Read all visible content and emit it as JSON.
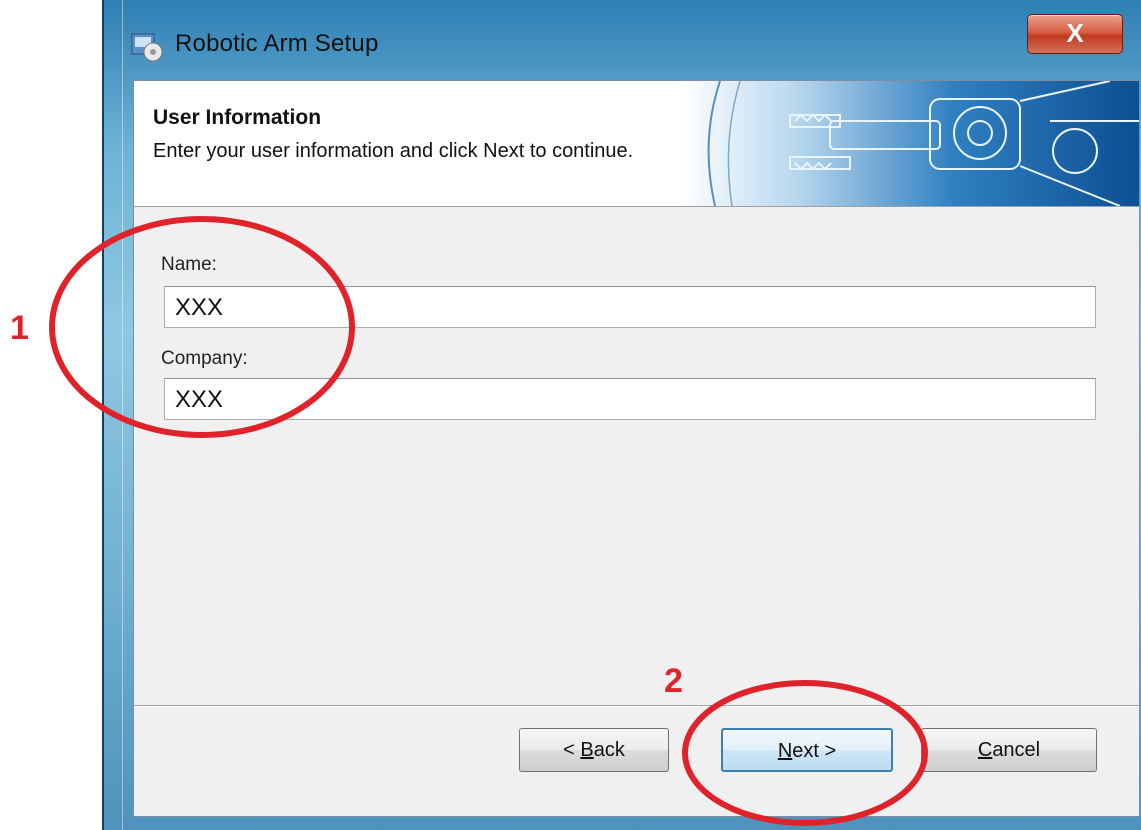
{
  "window": {
    "title": "Robotic Arm Setup",
    "close_label": "X",
    "icon": "setup-installer-icon"
  },
  "header": {
    "title": "User Information",
    "subtitle": "Enter your user information and click Next to continue.",
    "banner_image": "robotic-arm-banner"
  },
  "form": {
    "name_label": "Name:",
    "name_value": "XXX",
    "company_label": "Company:",
    "company_value": "XXX"
  },
  "buttons": {
    "back": {
      "prefix": "< ",
      "mnemonic": "B",
      "rest": "ack"
    },
    "next": {
      "mnemonic": "N",
      "rest": "ext >"
    },
    "cancel": {
      "mnemonic": "C",
      "rest": "ancel"
    }
  },
  "annotations": {
    "step1": "1",
    "step2": "2",
    "color": "#e0232b"
  }
}
